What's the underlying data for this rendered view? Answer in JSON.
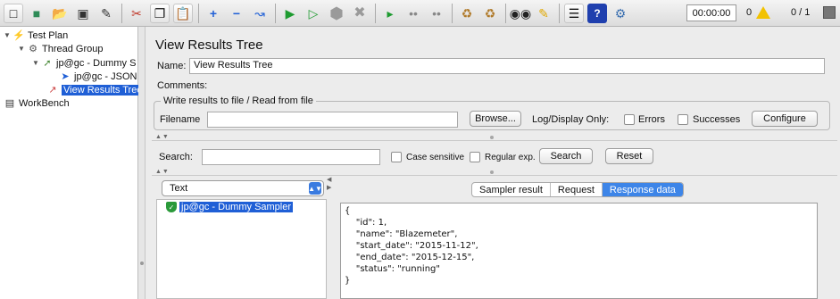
{
  "toolbar": {
    "timer": "00:00:00",
    "error_count": "0",
    "thread_count": "0 / 1",
    "icons": [
      "new-icon",
      "templates-icon",
      "open-icon",
      "save-icon",
      "save-as-icon",
      "cut-icon",
      "copy-icon",
      "paste-icon",
      "expand-icon",
      "collapse-icon",
      "toggle-icon",
      "start-icon",
      "start-no-pauses-icon",
      "stop-icon",
      "shutdown-icon",
      "remote-start-icon",
      "remote-stop-icon",
      "remote-shutdown-icon",
      "clear-icon",
      "clear-all-icon",
      "search-icon",
      "reset-search-icon",
      "function-helper-icon",
      "help-icon",
      "remote-icon"
    ]
  },
  "tree": {
    "items": [
      {
        "label": "Test Plan"
      },
      {
        "label": "Thread Group"
      },
      {
        "label": "jp@gc - Dummy S"
      },
      {
        "label": "jp@gc - JSON"
      },
      {
        "label": "View Results Tree"
      },
      {
        "label": "WorkBench"
      }
    ]
  },
  "panel": {
    "title": "View Results Tree",
    "name_label": "Name:",
    "name_value": "View Results Tree",
    "comments_label": "Comments:",
    "group_title": "Write results to file / Read from file",
    "filename_label": "Filename",
    "filename_value": "",
    "browse_label": "Browse...",
    "log_display_label": "Log/Display Only:",
    "errors_label": "Errors",
    "successes_label": "Successes",
    "configure_label": "Configure"
  },
  "search": {
    "label": "Search:",
    "value": "",
    "case_sensitive_label": "Case sensitive",
    "regex_label": "Regular exp.",
    "search_button": "Search",
    "reset_button": "Reset"
  },
  "results": {
    "renderer": "Text",
    "items": [
      {
        "label": "jp@gc - Dummy Sampler",
        "status": "success"
      }
    ],
    "tabs": [
      "Sampler result",
      "Request",
      "Response data"
    ],
    "active_tab": "Response data",
    "response_text": "{\n    \"id\": 1,\n    \"name\": \"Blazemeter\",\n    \"start_date\": \"2015-11-12\",\n    \"end_date\": \"2015-12-15\",\n    \"status\": \"running\"\n}"
  }
}
